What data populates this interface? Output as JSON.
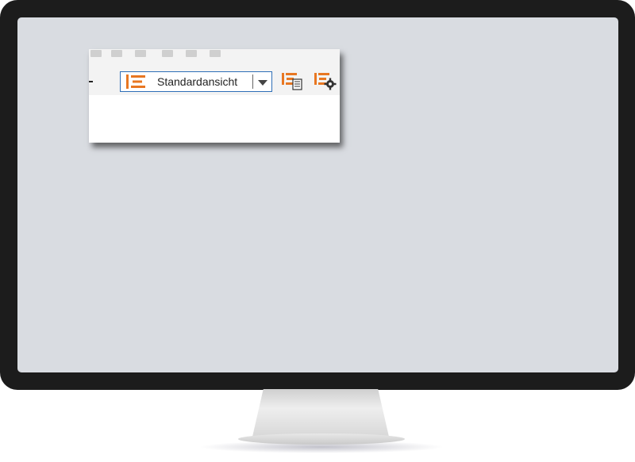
{
  "toolbar": {
    "view_selector": {
      "selected": "Standardansicht",
      "icon": "list-view-icon"
    },
    "buttons": [
      {
        "icon": "list-details-icon"
      },
      {
        "icon": "list-settings-icon"
      }
    ],
    "faded_icons": [
      "back-icon",
      "forward-icon",
      "add-icon",
      "copy-icon",
      "delete-icon",
      "edit-icon"
    ]
  },
  "colors": {
    "accent_orange": "#e87722",
    "selector_border": "#2f6fb7",
    "screen_bg": "#d9dce1",
    "bezel": "#1c1c1c"
  }
}
